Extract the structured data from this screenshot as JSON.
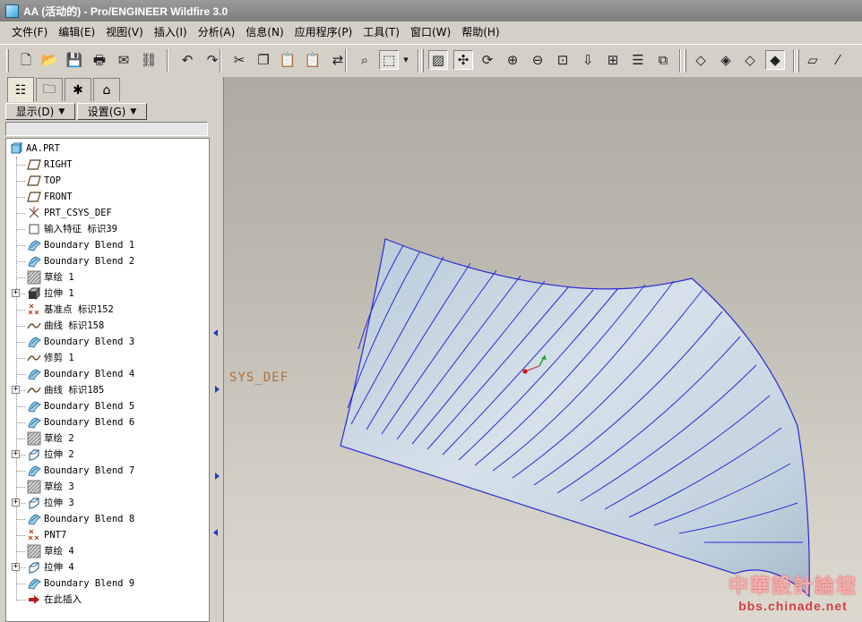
{
  "window": {
    "title": "AA (活动的) - Pro/ENGINEER Wildfire 3.0"
  },
  "menubar": {
    "items": [
      "文件(F)",
      "编辑(E)",
      "视图(V)",
      "插入(I)",
      "分析(A)",
      "信息(N)",
      "应用程序(P)",
      "工具(T)",
      "窗口(W)",
      "帮助(H)"
    ]
  },
  "toolbar": {
    "buttons": [
      {
        "name": "new",
        "glyph": "🗋"
      },
      {
        "name": "open",
        "glyph": "📂"
      },
      {
        "name": "save",
        "glyph": "💾"
      },
      {
        "name": "print",
        "glyph": "🖶"
      },
      {
        "name": "send-mail",
        "glyph": "✉"
      },
      {
        "name": "send-link",
        "glyph": "⛓"
      },
      {
        "name": "undo",
        "glyph": "↶"
      },
      {
        "name": "redo",
        "glyph": "↷"
      },
      {
        "name": "cut",
        "glyph": "✂"
      },
      {
        "name": "copy",
        "glyph": "❐"
      },
      {
        "name": "paste",
        "glyph": "📋"
      },
      {
        "name": "paste-special",
        "glyph": "📋"
      },
      {
        "name": "regenerate",
        "glyph": "⇄"
      },
      {
        "name": "find",
        "glyph": "⌕"
      },
      {
        "name": "select-box",
        "glyph": "⬚"
      },
      {
        "name": "select-dropdown",
        "glyph": "▾"
      },
      {
        "name": "repaint",
        "glyph": "▨"
      },
      {
        "name": "spin-center",
        "glyph": "✣"
      },
      {
        "name": "orient-mode",
        "glyph": "⟳"
      },
      {
        "name": "zoom-in",
        "glyph": "⊕"
      },
      {
        "name": "zoom-out",
        "glyph": "⊖"
      },
      {
        "name": "refit",
        "glyph": "⊡"
      },
      {
        "name": "reorient",
        "glyph": "⇩"
      },
      {
        "name": "saved-views",
        "glyph": "⊞"
      },
      {
        "name": "layers",
        "glyph": "☰"
      },
      {
        "name": "view-manager",
        "glyph": "⧉"
      },
      {
        "name": "wireframe",
        "glyph": "◇"
      },
      {
        "name": "hidden-line",
        "glyph": "◈"
      },
      {
        "name": "no-hidden",
        "glyph": "◇"
      },
      {
        "name": "shading",
        "glyph": "◆"
      },
      {
        "name": "datum-planes",
        "glyph": "▱"
      },
      {
        "name": "datum-axes",
        "glyph": "⁄"
      }
    ]
  },
  "navigator": {
    "tabs": [
      {
        "name": "model-tree",
        "glyph": "☷"
      },
      {
        "name": "folder-browser",
        "glyph": "🗀"
      },
      {
        "name": "favorites",
        "glyph": "✱"
      },
      {
        "name": "connections",
        "glyph": "⌂"
      }
    ],
    "show_label": "显示(D)",
    "settings_label": "设置(G)"
  },
  "model_tree": {
    "root": "AA.PRT",
    "items": [
      {
        "label": "RIGHT",
        "icon": "datum-plane",
        "expandable": false
      },
      {
        "label": "TOP",
        "icon": "datum-plane",
        "expandable": false
      },
      {
        "label": "FRONT",
        "icon": "datum-plane",
        "expandable": false
      },
      {
        "label": "PRT_CSYS_DEF",
        "icon": "csys",
        "expandable": false
      },
      {
        "label": "输入特征 标识39",
        "icon": "import",
        "expandable": false
      },
      {
        "label": "Boundary Blend 1",
        "icon": "boundary-blend",
        "expandable": false
      },
      {
        "label": "Boundary Blend 2",
        "icon": "boundary-blend",
        "expandable": false
      },
      {
        "label": "草绘 1",
        "icon": "sketch",
        "expandable": false
      },
      {
        "label": "拉伸 1",
        "icon": "extrude-solid",
        "expandable": true
      },
      {
        "label": "基准点 标识152",
        "icon": "datum-point",
        "expandable": false
      },
      {
        "label": "曲线 标识158",
        "icon": "curve",
        "expandable": false
      },
      {
        "label": "Boundary Blend 3",
        "icon": "boundary-blend",
        "expandable": false
      },
      {
        "label": "修剪 1",
        "icon": "curve",
        "expandable": false
      },
      {
        "label": "Boundary Blend 4",
        "icon": "boundary-blend",
        "expandable": false
      },
      {
        "label": "曲线 标识185",
        "icon": "curve",
        "expandable": true
      },
      {
        "label": "Boundary Blend 5",
        "icon": "boundary-blend",
        "expandable": false
      },
      {
        "label": "Boundary Blend 6",
        "icon": "boundary-blend",
        "expandable": false
      },
      {
        "label": "草绘 2",
        "icon": "sketch",
        "expandable": false
      },
      {
        "label": "拉伸 2",
        "icon": "extrude-surface",
        "expandable": true
      },
      {
        "label": "Boundary Blend 7",
        "icon": "boundary-blend",
        "expandable": false
      },
      {
        "label": "草绘 3",
        "icon": "sketch",
        "expandable": false
      },
      {
        "label": "拉伸 3",
        "icon": "extrude-surface",
        "expandable": true
      },
      {
        "label": "Boundary Blend 8",
        "icon": "boundary-blend",
        "expandable": false
      },
      {
        "label": "PNT7",
        "icon": "datum-point",
        "expandable": false
      },
      {
        "label": "草绘 4",
        "icon": "sketch",
        "expandable": false
      },
      {
        "label": "拉伸 4",
        "icon": "extrude-surface",
        "expandable": true
      },
      {
        "label": "Boundary Blend 9",
        "icon": "boundary-blend",
        "expandable": false
      },
      {
        "label": "在此插入",
        "icon": "insert-here",
        "expandable": false
      }
    ]
  },
  "graphics": {
    "csys_label": "SYS_DEF",
    "surface_color": "#c5d4e2",
    "edge_color": "#2b2bd6"
  },
  "watermark": {
    "text": "中華設計論壇",
    "url": "bbs.chinade.net"
  }
}
